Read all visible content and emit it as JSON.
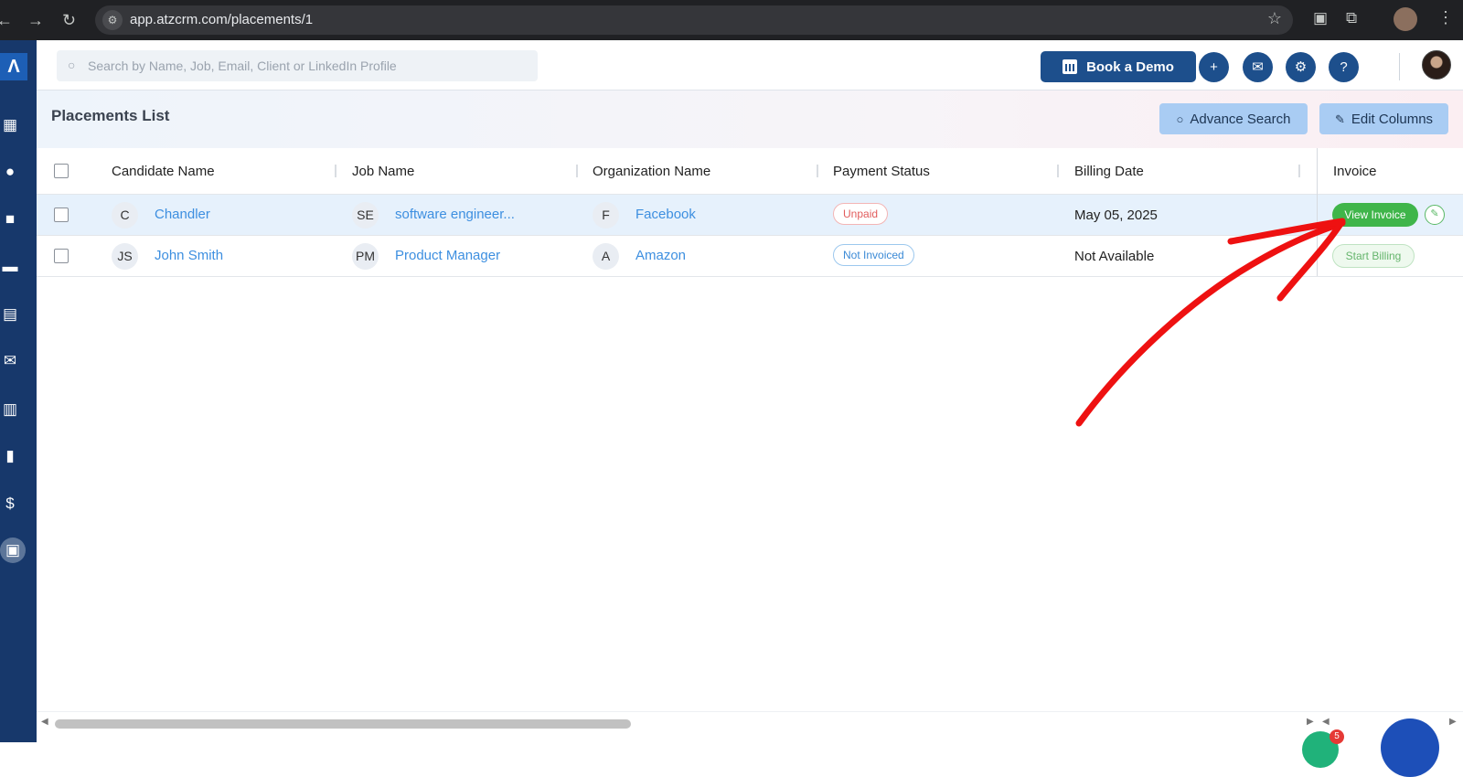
{
  "browser": {
    "url": "app.atzcrm.com/placements/1"
  },
  "search": {
    "placeholder": "Search by Name, Job, Email, Client or LinkedIn Profile"
  },
  "topbar": {
    "book_demo_label": "Book a Demo"
  },
  "page": {
    "title": "Placements List",
    "advance_search_label": "Advance Search",
    "edit_columns_label": "Edit Columns"
  },
  "table": {
    "headers": {
      "candidate": "Candidate Name",
      "job": "Job Name",
      "organization": "Organization Name",
      "payment": "Payment Status",
      "billing": "Billing Date",
      "invoice": "Invoice"
    },
    "rows": [
      {
        "candidate_initials": "C",
        "candidate": "Chandler",
        "job_initials": "SE",
        "job": "software engineer...",
        "org_initials": "F",
        "organization": "Facebook",
        "payment_status": "Unpaid",
        "billing_date": "May 05, 2025",
        "invoice_action": "View Invoice"
      },
      {
        "candidate_initials": "JS",
        "candidate": "John Smith",
        "job_initials": "PM",
        "job": "Product Manager",
        "org_initials": "A",
        "organization": "Amazon",
        "payment_status": "Not Invoiced",
        "billing_date": "Not Available",
        "invoice_action": "Start Billing"
      }
    ]
  },
  "notifications": {
    "badge_count": "5"
  },
  "colors": {
    "sidebar": "#17386b",
    "primary": "#1d4f8c",
    "link": "#3d8fe0",
    "success": "#3fb54a",
    "danger": "#e15c5c",
    "annotation": "#ee1111"
  },
  "icons": {
    "sidebar": [
      "dashboard-icon",
      "candidate-icon",
      "job-icon",
      "client-icon",
      "contact-icon",
      "email-icon",
      "calendar-icon",
      "reports-icon",
      "billing-icon",
      "placements-icon"
    ],
    "topbar": [
      "plus-icon",
      "mail-icon",
      "gear-icon",
      "help-icon"
    ]
  }
}
